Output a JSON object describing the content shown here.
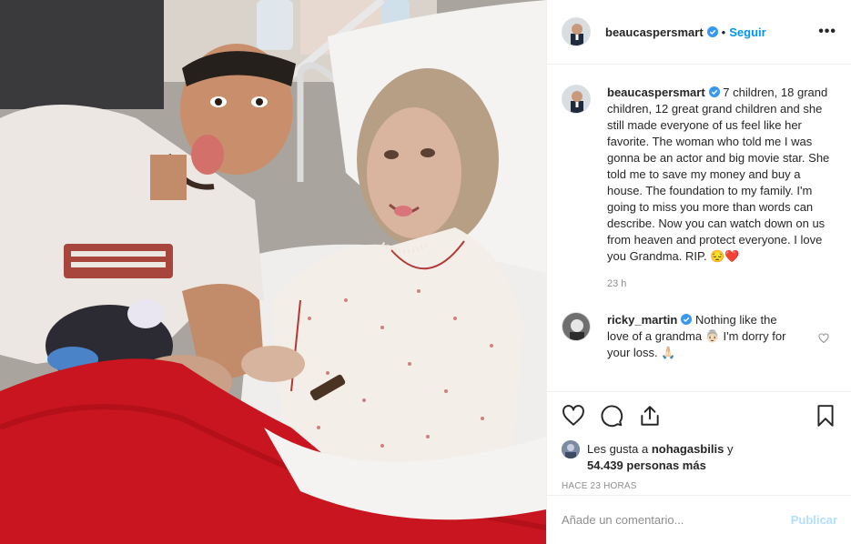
{
  "post": {
    "author": "beaucaspersmart",
    "follow_label": "Seguir",
    "separator": "•",
    "more_label": "•••"
  },
  "caption": {
    "user": "beaucaspersmart",
    "text": "7 children, 18 grand children, 12 great grand children and she still made everyone of us feel like her favorite. The woman who told me I was gonna be an actor and big movie star. She told me to save my money and buy a house. The foundation to my family. I'm going to miss you more than words can describe. Now you can watch down on us from heaven and protect everyone. I love you Grandma. RIP. 😔❤️",
    "time": "23 h"
  },
  "comment": {
    "user": "ricky_martin",
    "text": "Nothing like the love of a grandma 👵🏻 I'm dorry for your loss. 🙏🏻"
  },
  "likes": {
    "prefix": "Les gusta a",
    "user": "nohagasbilis",
    "middle": "y",
    "count": "54.439 personas más"
  },
  "posted_ago": "HACE 23 HORAS",
  "add_comment": {
    "placeholder": "Añade un comentario...",
    "publish_label": "Publicar"
  },
  "icons": {
    "verified": "verified-badge-icon",
    "like": "heart-icon",
    "comment": "comment-bubble-icon",
    "share": "share-icon",
    "save": "bookmark-icon"
  },
  "colors": {
    "link": "#0095f6",
    "verified": "#3897f0",
    "muted": "#8e8e8e",
    "publish_disabled": "#b2dffc",
    "blanket": "#c8151f"
  }
}
